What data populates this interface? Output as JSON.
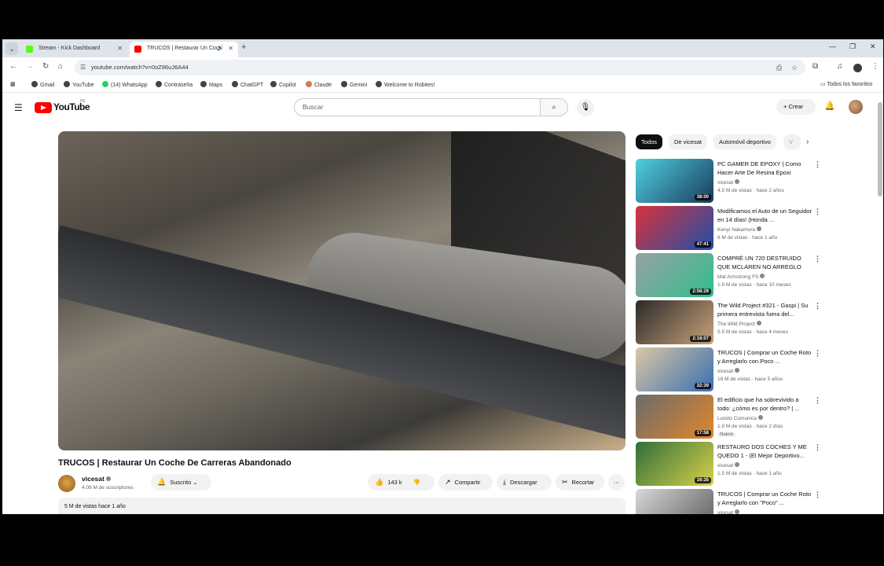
{
  "browser": {
    "tabs": [
      {
        "label": "Stream - Kick Dashboard",
        "color": "#53fc18"
      },
      {
        "label": "TRUCOS | Restaurar Un Coc",
        "color": "#ff0000"
      }
    ],
    "url": "youtube.com/watch?v=0oZ86uJ6A44",
    "bookmarks": [
      "Gmail",
      "YouTube",
      "(14) WhatsApp",
      "Contraseña",
      "Maps",
      "ChatGPT",
      "Copilot",
      "Claude",
      "Gemini",
      "Welcome to Robites!"
    ],
    "all_bookmarks": "Todos los favoritos"
  },
  "youtube": {
    "logo_text": "YouTube",
    "country_code": "PE",
    "search_placeholder": "Buscar",
    "create_label": "Crear"
  },
  "video": {
    "title": "TRUCOS | Restaurar Un Coche De Carreras Abandonado",
    "channel": "vicesat",
    "subscribers": "4.08 M de suscriptores",
    "subscribed_label": "Suscrito",
    "likes": "143 k",
    "share_label": "Compartir",
    "download_label": "Descargar",
    "clip_label": "Recortar",
    "views_date": "5 M de vistas  hace 1 año"
  },
  "chips": [
    "Todos",
    "De vicesat",
    "Automóvil deportivo",
    "V"
  ],
  "recommendations": [
    {
      "title": "PC GAMER DE EPOXY | Como Hacer Arte De Resina Epoxi",
      "channel": "vicesat",
      "meta": "4.5 M de vistas · hace 2 años",
      "duration": "38:00",
      "c1": "#4fd1e0",
      "c2": "#1a3b5c"
    },
    {
      "title": "Modificamos el Auto de un Seguidor en 14 días! (Honda ...",
      "channel": "Kenyi Nakamura",
      "meta": "6 M de vistas · hace 1 año",
      "duration": "47:41",
      "c1": "#d8333a",
      "c2": "#1f4fa8"
    },
    {
      "title": "COMPRÉ UN 720 DESTRUIDO QUE MCLAREN NO ARREGLO",
      "channel": "Mat Armstrong FS",
      "meta": "1.9 M de vistas · hace 10 meses",
      "duration": "2:58:29",
      "c1": "#9aa0a6",
      "c2": "#2fbf8a"
    },
    {
      "title": "The Wild Project #321 - Gaspi | Su primera entrevista fuera del...",
      "channel": "The Wild Project",
      "meta": "5.5 M de vistas · hace 4 meses",
      "duration": "2:18:07",
      "c1": "#2a2a2a",
      "c2": "#c9a27a"
    },
    {
      "title": "TRUCOS | Comprar un Coche Roto y Arreglarlo con Poco ...",
      "channel": "vicesat",
      "meta": "18 M de vistas · hace 5 años",
      "duration": "32:39",
      "c1": "#d9c7a6",
      "c2": "#3a6fb0"
    },
    {
      "title": "El edificio que ha sobrevivido a todo: ¿cómo es por dentro? | ...",
      "channel": "Luisito Comunica",
      "meta": "1.9 M de vistas · hace 2 días",
      "duration": "17:58",
      "badge": "Nuevo",
      "c1": "#6b6b6b",
      "c2": "#e0872b"
    },
    {
      "title": "RESTAURO DOS COCHES Y ME QUEDO 1 - (El Mejor Deportivo...",
      "channel": "vicesat",
      "meta": "1.5 M de vistas · hace 1 año",
      "duration": "16:35",
      "c1": "#2f6f3a",
      "c2": "#d9d04a"
    },
    {
      "title": "TRUCOS | Comprar un Coche Roto y Arreglarlo con \"Poco\" ...",
      "channel": "vicesat",
      "meta": "",
      "duration": "",
      "c1": "#d8d8d8",
      "c2": "#5a5a5a"
    }
  ]
}
